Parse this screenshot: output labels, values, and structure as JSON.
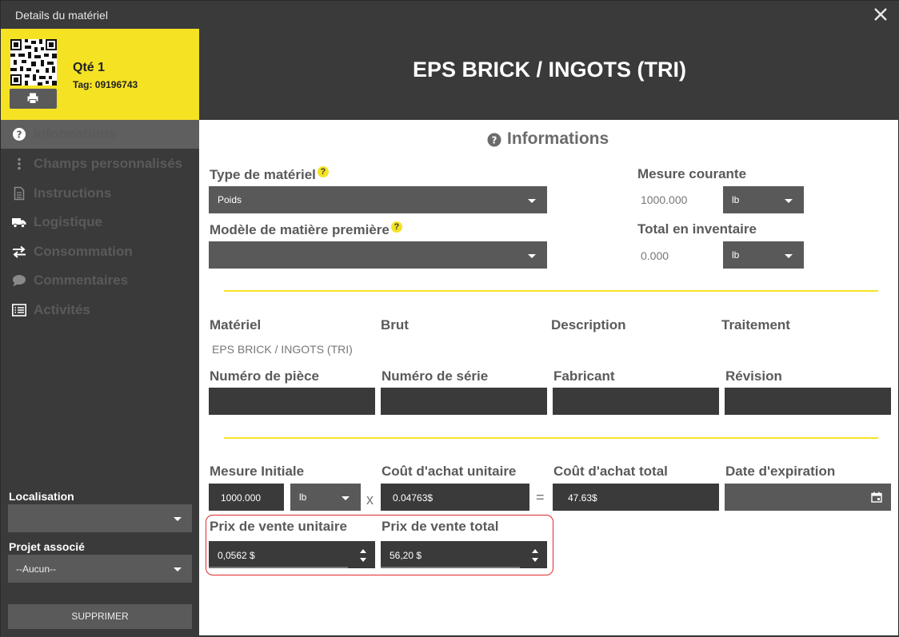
{
  "window": {
    "title": "Details du matériel"
  },
  "tag": {
    "qty": "Qté 1",
    "tag_number": "Tag: 09196743"
  },
  "nav": [
    {
      "label": "Informations",
      "icon": "question-circle-icon",
      "state": "active"
    },
    {
      "label": "Champs personnalisés",
      "icon": "vertical-dots-icon",
      "state": "disabled"
    },
    {
      "label": "Instructions",
      "icon": "document-icon",
      "state": "disabled"
    },
    {
      "label": "Logistique",
      "icon": "truck-icon",
      "state": "normal"
    },
    {
      "label": "Consommation",
      "icon": "exchange-arrows-icon",
      "state": "normal"
    },
    {
      "label": "Commentaires",
      "icon": "comment-icon",
      "state": "disabled"
    },
    {
      "label": "Activités",
      "icon": "list-icon",
      "state": "normal"
    }
  ],
  "side": {
    "location_label": "Localisation",
    "location_value": "",
    "project_label": "Projet associé",
    "project_value": "--Aucun--",
    "delete_label": "SUPPRIMER"
  },
  "header": {
    "title": "EPS BRICK / INGOTS (TRI)"
  },
  "section": {
    "title": "Informations"
  },
  "fields": {
    "material_type_label": "Type de matériel",
    "material_type_value": "Poids",
    "raw_model_label": "Modèle de matière première",
    "raw_model_value": "",
    "current_measure_label": "Mesure courante",
    "current_measure_value": "1000.000",
    "current_measure_unit": "lb",
    "inventory_total_label": "Total en inventaire",
    "inventory_total_value": "0.000",
    "inventory_total_unit": "lb",
    "material_label": "Matériel",
    "material_value": "EPS BRICK / INGOTS (TRI)",
    "brut_label": "Brut",
    "description_label": "Description",
    "treatment_label": "Traitement",
    "part_number_label": "Numéro de pièce",
    "serial_number_label": "Numéro de série",
    "manufacturer_label": "Fabricant",
    "revision_label": "Révision",
    "initial_measure_label": "Mesure Initiale",
    "initial_measure_value": "1000.000",
    "initial_measure_unit": "lb",
    "unit_cost_label": "Coût d'achat unitaire",
    "unit_cost_value": "0.04763$",
    "total_cost_label": "Coût d'achat total",
    "total_cost_value": "47.63$",
    "expiry_label": "Date d'expiration",
    "expiry_value": "",
    "unit_price_label": "Prix de vente unitaire",
    "unit_price_value": "0,0562 $",
    "total_price_label": "Prix de vente total",
    "total_price_value": "56,20 $",
    "times_sign": "x",
    "equals_sign": "="
  },
  "colors": {
    "accent": "#f5e223",
    "dark": "#3a3a3a",
    "highlight": "#e02a2a"
  }
}
